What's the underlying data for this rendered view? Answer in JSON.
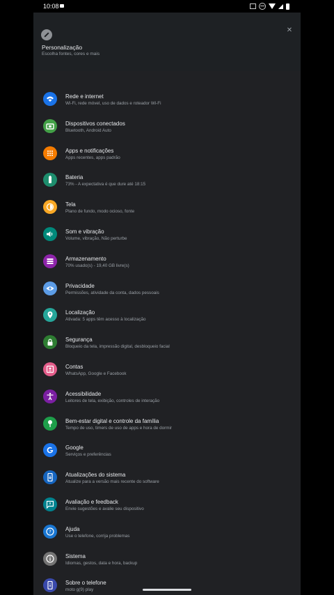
{
  "status_bar": {
    "time": "10:08"
  },
  "header": {
    "title": "Personalização",
    "subtitle": "Escolha fontes, cores e mais"
  },
  "items": [
    {
      "title": "Rede e internet",
      "subtitle": "Wi-Fi, rede móvel, uso de dados e roteador Wi-Fi",
      "color": "#1a73e8",
      "icon": "wifi-icon"
    },
    {
      "title": "Dispositivos conectados",
      "subtitle": "Bluetooth, Android Auto",
      "color": "#43a047",
      "icon": "devices-icon"
    },
    {
      "title": "Apps e notificações",
      "subtitle": "Apps recentes, apps padrão",
      "color": "#f57c00",
      "icon": "apps-icon"
    },
    {
      "title": "Bateria",
      "subtitle": "73% - A expectativa é que dure até 18:15",
      "color": "#1e8e6e",
      "icon": "battery-icon"
    },
    {
      "title": "Tela",
      "subtitle": "Plano de fundo, modo ocioso, fonte",
      "color": "#f9a825",
      "icon": "display-icon"
    },
    {
      "title": "Som e vibração",
      "subtitle": "Volume, vibração, Não perturbe",
      "color": "#00897b",
      "icon": "volume-icon"
    },
    {
      "title": "Armazenamento",
      "subtitle": "70% usado(s) - 19,40 GB livre(s)",
      "color": "#8e24aa",
      "icon": "storage-icon"
    },
    {
      "title": "Privacidade",
      "subtitle": "Permissões, atividade da conta, dados pessoais",
      "color": "#5c9ce6",
      "icon": "privacy-icon"
    },
    {
      "title": "Localização",
      "subtitle": "Ativada: 5 apps têm acesso à localização",
      "color": "#26a69a",
      "icon": "location-icon"
    },
    {
      "title": "Segurança",
      "subtitle": "Bloqueio da tela, impressão digital, desbloqueio facial",
      "color": "#2e7d32",
      "icon": "lock-icon"
    },
    {
      "title": "Contas",
      "subtitle": "WhatsApp, Google e Facebook",
      "color": "#e35d8a",
      "icon": "account-icon"
    },
    {
      "title": "Acessibilidade",
      "subtitle": "Leitores de tela, exibição, controles de interação",
      "color": "#7b1fa2",
      "icon": "accessibility-icon"
    },
    {
      "title": "Bem-estar digital e controle da família",
      "subtitle": "Tempo de uso, timers de uso de apps e hora de dormir",
      "color": "#1e9e4a",
      "icon": "wellbeing-icon"
    },
    {
      "title": "Google",
      "subtitle": "Serviços e preferências",
      "color": "#1a73e8",
      "icon": "google-icon"
    },
    {
      "title": "Atualizações do sistema",
      "subtitle": "Atualize para a versão mais recente do software",
      "color": "#1565c0",
      "icon": "system-update-icon"
    },
    {
      "title": "Avaliação e feedback",
      "subtitle": "Envie sugestões e avalie seu dispositivo",
      "color": "#00838f",
      "icon": "feedback-icon"
    },
    {
      "title": "Ajuda",
      "subtitle": "Use o telefone, corrija problemas",
      "color": "#1976d2",
      "icon": "help-icon"
    },
    {
      "title": "Sistema",
      "subtitle": "Idiomas, gestos, data e hora, backup",
      "color": "#757575",
      "icon": "info-icon"
    },
    {
      "title": "Sobre o telefone",
      "subtitle": "moto g(9) play",
      "color": "#3949ab",
      "icon": "phone-icon"
    }
  ]
}
